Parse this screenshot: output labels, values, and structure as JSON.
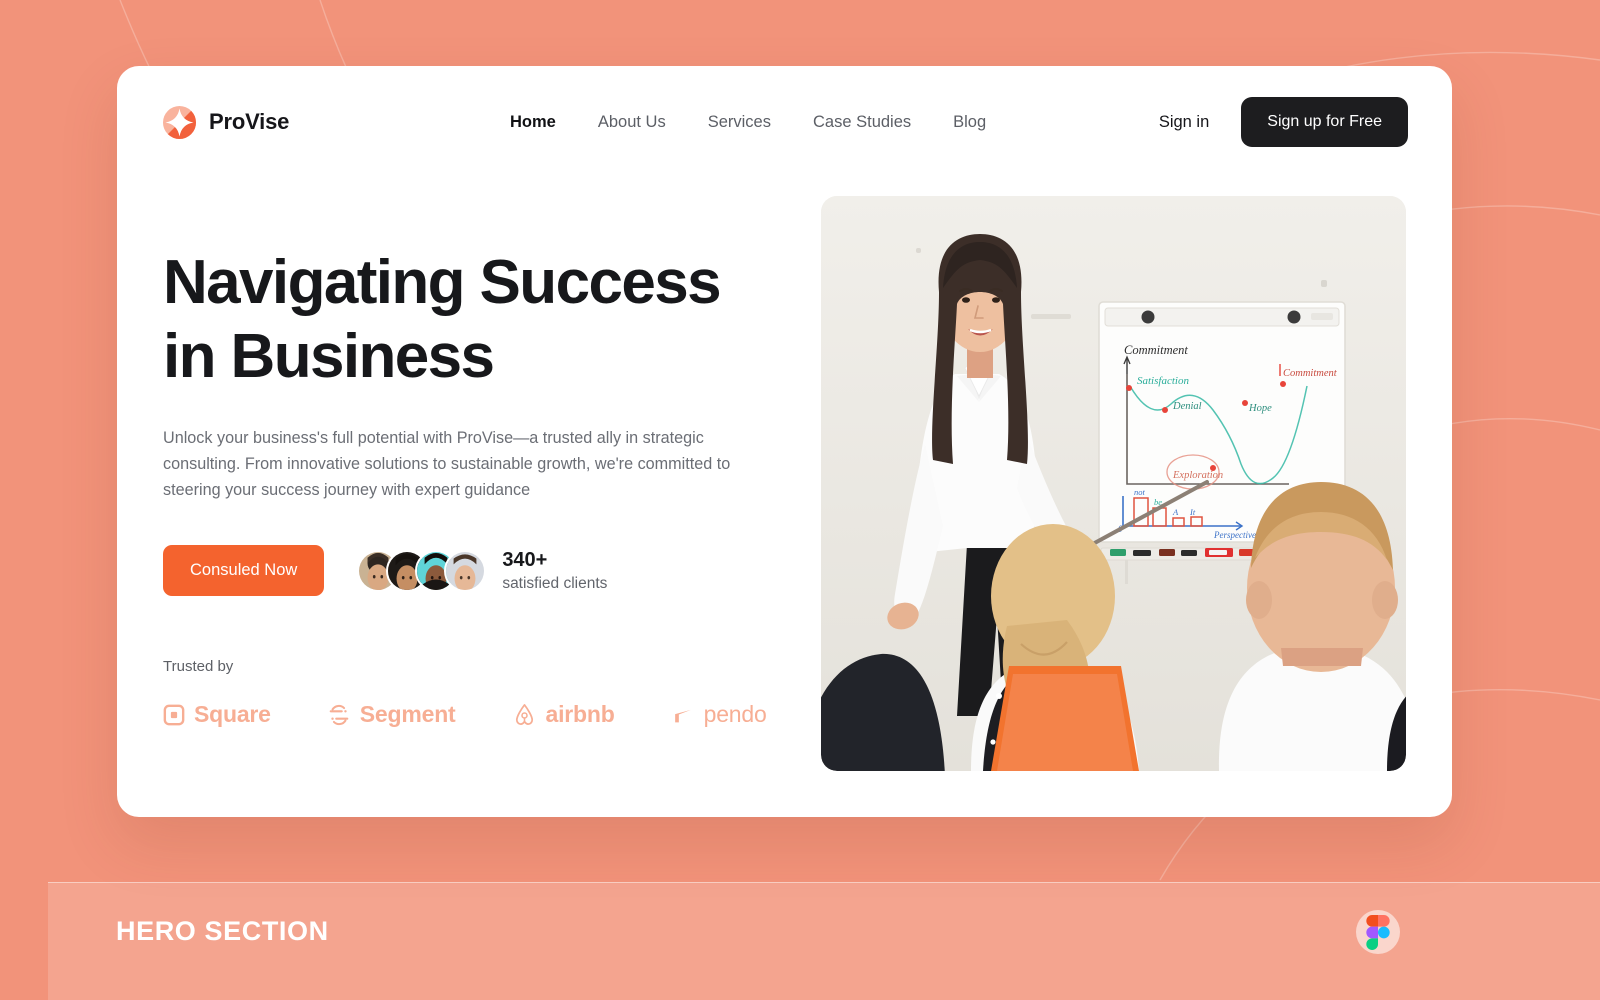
{
  "page": {
    "background_color": "#F2937A",
    "card_background": "#FFFFFF",
    "accent_color": "#F4632E",
    "brand_logo_tint": "#F7AE94",
    "dark_button_color": "#1D1D1F"
  },
  "navbar": {
    "brand_name": "ProVise",
    "links": [
      {
        "label": "Home",
        "active": true
      },
      {
        "label": "About Us",
        "active": false
      },
      {
        "label": "Services",
        "active": false
      },
      {
        "label": "Case Studies",
        "active": false
      },
      {
        "label": "Blog",
        "active": false
      }
    ],
    "signin_label": "Sign in",
    "signup_label": "Sign up for Free"
  },
  "hero": {
    "headline": "Navigating Success\nin Business",
    "subheadline": "Unlock your business's full potential with ProVise—a trusted ally in strategic consulting. From innovative solutions to sustainable growth, we're committed to steering your success journey with expert guidance",
    "cta_label": "Consuled Now",
    "clients_count": "340+",
    "clients_caption": "satisfied clients",
    "avatar_count": 4
  },
  "trusted": {
    "label": "Trusted by",
    "logos": [
      {
        "name": "Square",
        "icon": "square-logo-icon",
        "bold": true
      },
      {
        "name": "Segment",
        "icon": "segment-logo-icon",
        "bold": true
      },
      {
        "name": "airbnb",
        "icon": "airbnb-logo-icon",
        "bold": true
      },
      {
        "name": "pendo",
        "icon": "pendo-logo-icon",
        "bold": false
      }
    ]
  },
  "hero_image": {
    "alt": "Business consultant presenting a commitment curve on a whiteboard to a seated audience",
    "whiteboard_labels": {
      "title": "Commitment",
      "points": [
        "Satisfaction",
        "Denial",
        "Hope",
        "Commitment",
        "Exploration"
      ],
      "chart_axis": "Perspective"
    }
  },
  "footer": {
    "section_label": "HERO SECTION",
    "figma_icon": "figma-logo-icon"
  }
}
